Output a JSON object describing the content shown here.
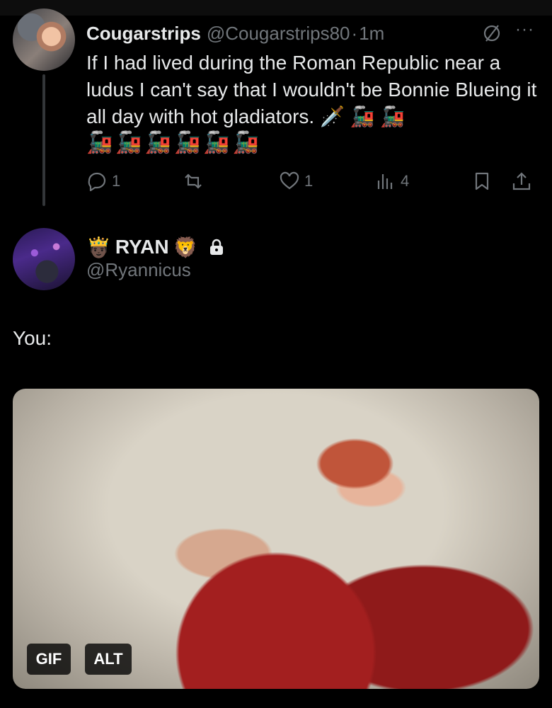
{
  "parent_tweet": {
    "author_name": "Cougarstrips",
    "author_handle": "@Cougarstrips80",
    "separator": "·",
    "time": "1m",
    "more_label": "···",
    "text": "If I had lived during the Roman Republic near a ludus I can't say that I wouldn't be Bonnie Blueing it all day with hot gladiators. 🗡️ 🚂 🚂",
    "emoji_line": "🚂🚂🚂🚂🚂🚂",
    "actions": {
      "reply_count": "1",
      "repost_count": "",
      "like_count": "1",
      "views_count": "4"
    }
  },
  "reply": {
    "author_name": "RYAN",
    "name_prefix_emoji": "🤴🏿",
    "name_suffix_emoji": "🦁",
    "author_handle": "@Ryannicus",
    "text": "You:",
    "media": {
      "gif_badge": "GIF",
      "alt_badge": "ALT"
    }
  },
  "colors": {
    "background": "#000000",
    "primary_text": "#e7e9ea",
    "secondary_text": "#71767b",
    "thread_line": "#333639"
  },
  "icons": [
    "reply-icon",
    "repost-icon",
    "like-icon",
    "views-icon",
    "bookmark-icon",
    "share-icon",
    "grok-icon",
    "lock-icon"
  ]
}
